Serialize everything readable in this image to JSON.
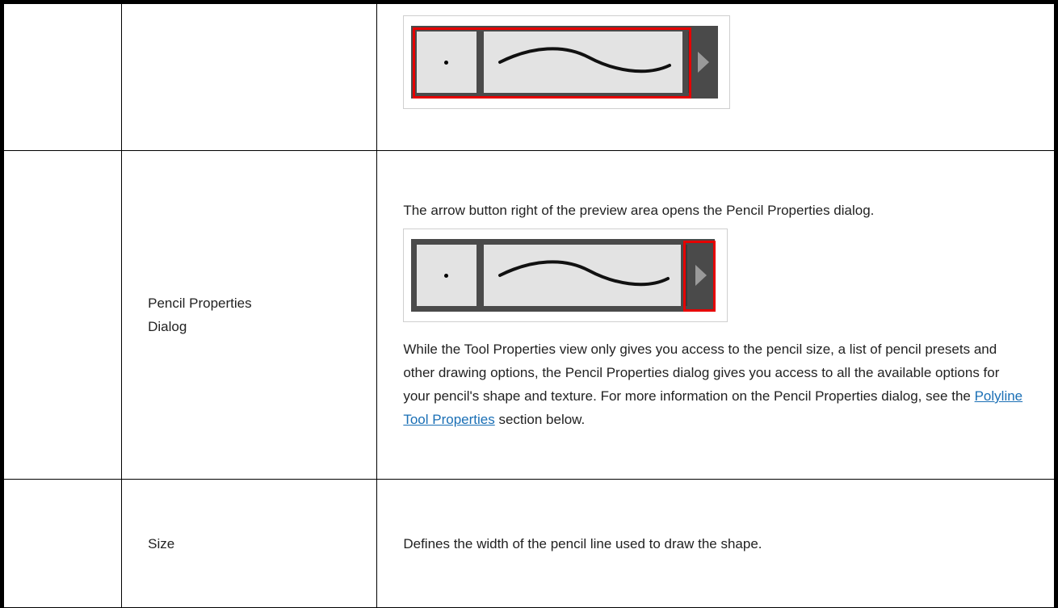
{
  "rows": [
    {
      "name": "",
      "description": ""
    },
    {
      "name": "Pencil Properties Dialog",
      "intro": "The arrow button right of the preview area opens the Pencil Properties dialog.",
      "body_before_link": "While the Tool Properties view only gives you access to the pencil size, a list of pencil presets and other drawing options, the Pencil Properties dialog gives you access to all the available options for your pencil's shape and texture. For more information on the Pencil Properties dialog, see the ",
      "link_text": "Polyline Tool Properties",
      "body_after_link": " section below."
    },
    {
      "name": "Size",
      "description": "Defines the width of the pencil line used to draw the shape."
    }
  ],
  "colors": {
    "highlight": "#e60000",
    "widget_dark": "#4a4a4a",
    "widget_light": "#e3e3e3",
    "link": "#1a6fb5"
  }
}
